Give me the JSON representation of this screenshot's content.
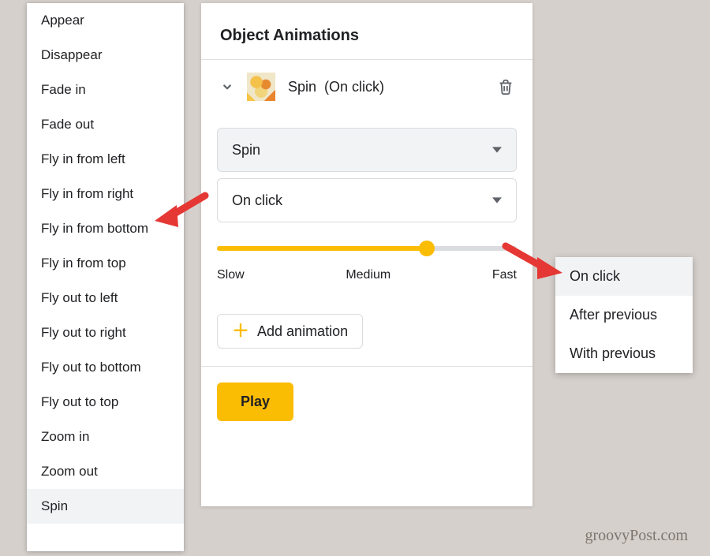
{
  "anim_list": {
    "items": [
      "Appear",
      "Disappear",
      "Fade in",
      "Fade out",
      "Fly in from left",
      "Fly in from right",
      "Fly in from bottom",
      "Fly in from top",
      "Fly out to left",
      "Fly out to right",
      "Fly out to bottom",
      "Fly out to top",
      "Zoom in",
      "Zoom out",
      "Spin"
    ],
    "selected_index": 14
  },
  "panel": {
    "title": "Object Animations",
    "object": {
      "name": "Spin",
      "trigger_suffix": "(On click)"
    },
    "anim_dropdown": {
      "value": "Spin"
    },
    "trigger_dropdown": {
      "value": "On click"
    },
    "slider": {
      "labels": {
        "slow": "Slow",
        "medium": "Medium",
        "fast": "Fast"
      },
      "percent": 70
    },
    "add_button": "Add animation",
    "play_button": "Play"
  },
  "trigger_list": {
    "items": [
      "On click",
      "After previous",
      "With previous"
    ],
    "selected_index": 0
  },
  "watermark": "groovyPost.com"
}
